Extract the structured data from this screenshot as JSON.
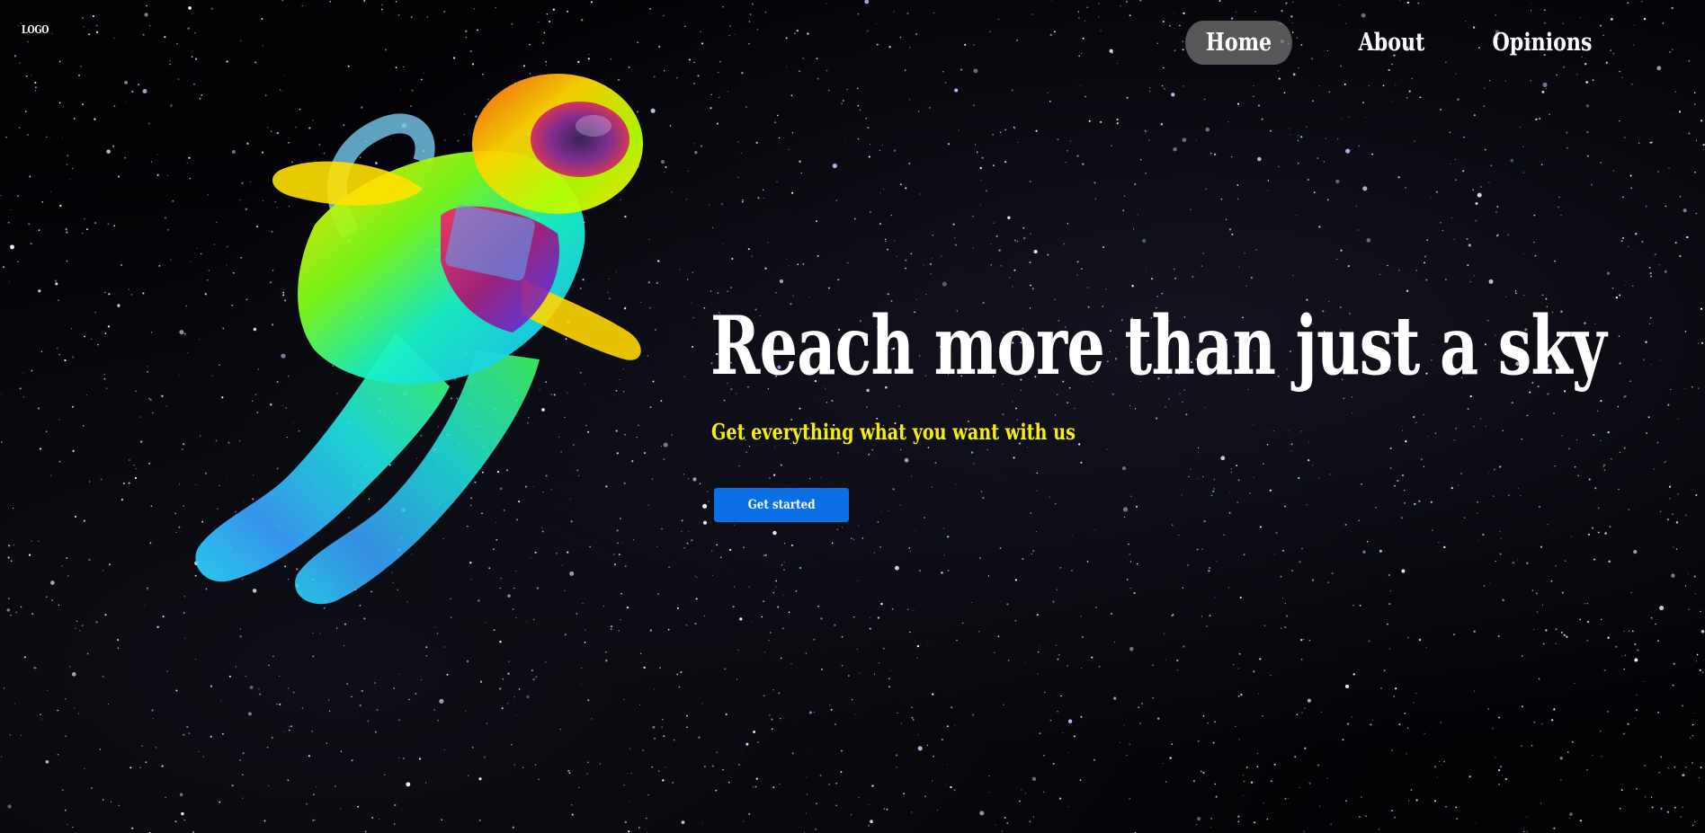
{
  "header": {
    "logo_text": "LOGO",
    "nav": [
      {
        "label": "Home",
        "active": true
      },
      {
        "label": "About",
        "active": false
      },
      {
        "label": "Opinions",
        "active": false
      }
    ]
  },
  "hero": {
    "title": "Reach more than just a sky",
    "subtitle": "Get everything what you want with us",
    "cta_label": "Get started",
    "image": "iridescent-astronaut-illustration"
  },
  "colors": {
    "background": "#000000",
    "nav_active_bg": "#6e6e6e",
    "subtitle": "#f5f006",
    "cta_bg": "#0b6fe6",
    "text": "#ffffff"
  }
}
